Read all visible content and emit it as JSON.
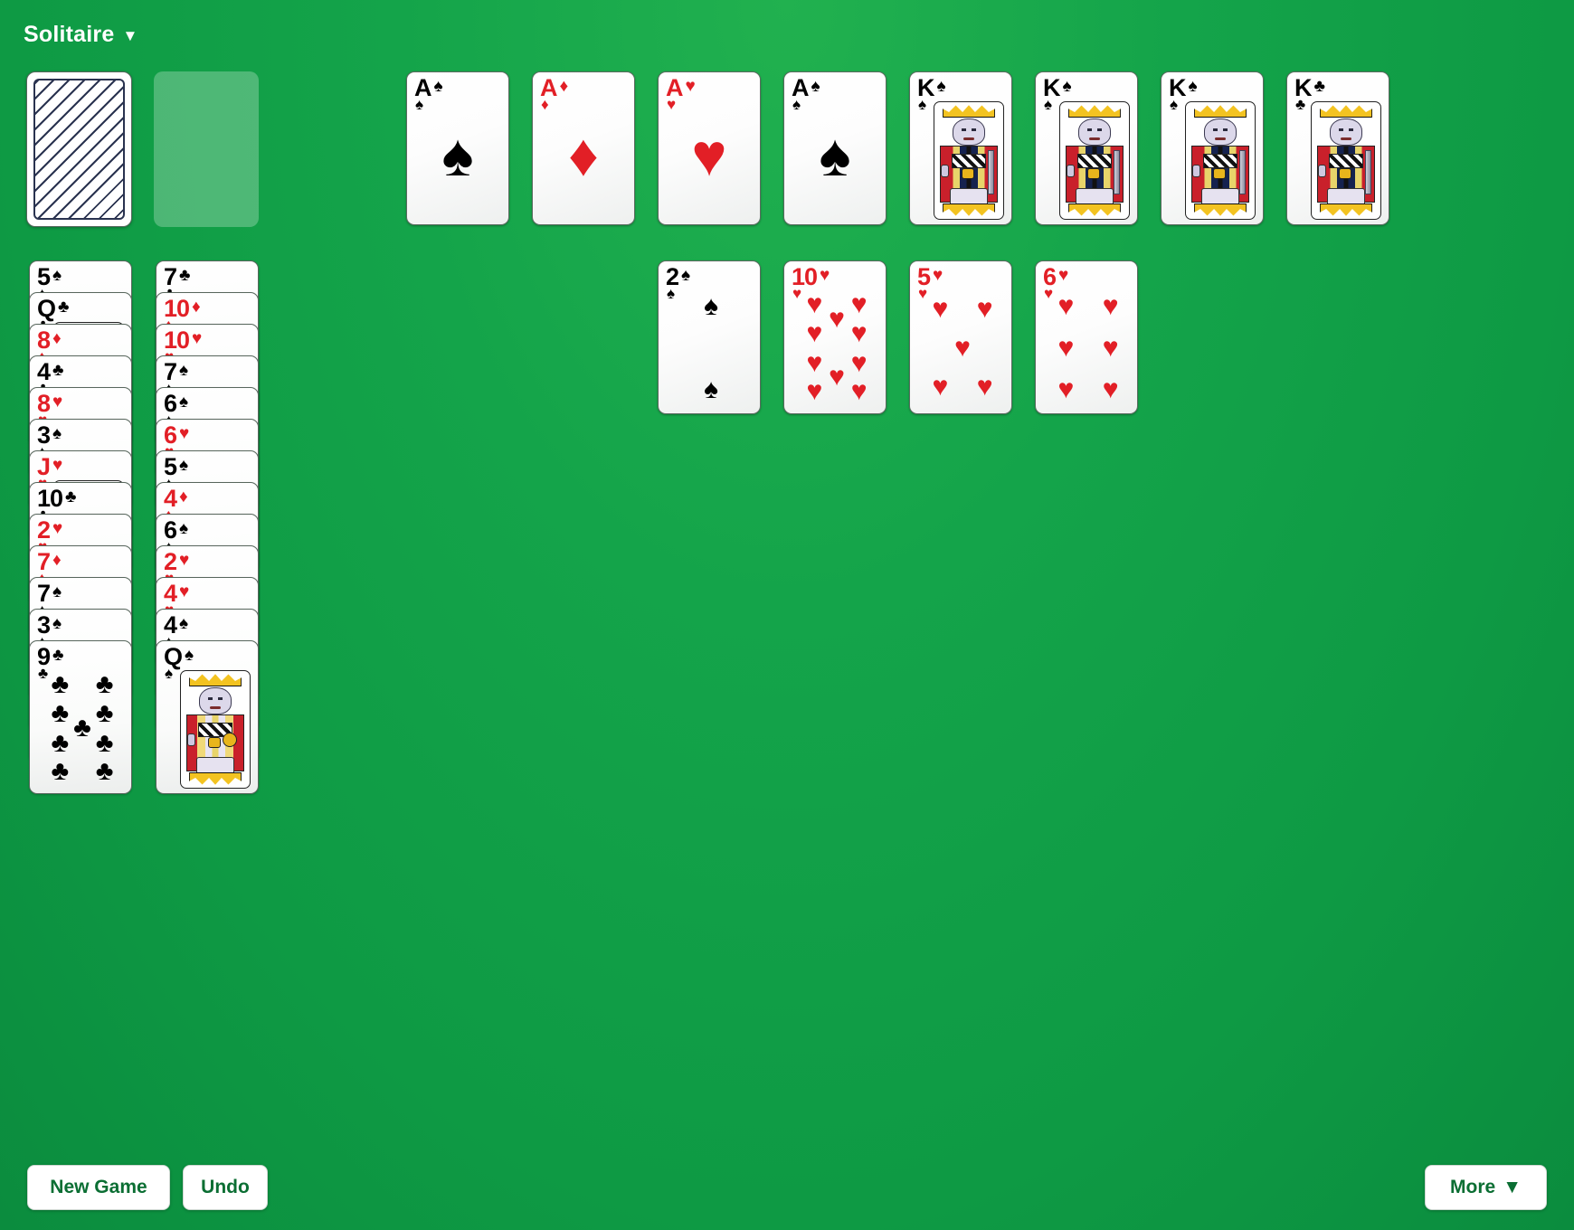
{
  "app": {
    "title": "Solitaire",
    "caret": "▼"
  },
  "colors": {
    "felt": "#14a44a",
    "red_suit": "#e21f26",
    "black_suit": "#000000",
    "button_text": "#0b6e33"
  },
  "stock": {
    "name": "stock-pile",
    "face_down": true
  },
  "waste": {
    "name": "waste-pile",
    "empty": true
  },
  "foundations": [
    {
      "rank": "A",
      "suit": "spades",
      "glyph": "♠",
      "color": "black"
    },
    {
      "rank": "A",
      "suit": "diamonds",
      "glyph": "♦",
      "color": "red"
    },
    {
      "rank": "A",
      "suit": "hearts",
      "glyph": "♥",
      "color": "red"
    },
    {
      "rank": "A",
      "suit": "spades",
      "glyph": "♠",
      "color": "black"
    },
    {
      "rank": "K",
      "suit": "spades",
      "glyph": "♠",
      "color": "black"
    },
    {
      "rank": "K",
      "suit": "spades",
      "glyph": "♠",
      "color": "black"
    },
    {
      "rank": "K",
      "suit": "spades",
      "glyph": "♠",
      "color": "black"
    },
    {
      "rank": "K",
      "suit": "clubs",
      "glyph": "♣",
      "color": "black"
    }
  ],
  "free_row": [
    {
      "rank": "2",
      "suit": "spades",
      "glyph": "♠",
      "color": "black"
    },
    {
      "rank": "10",
      "suit": "hearts",
      "glyph": "♥",
      "color": "red"
    },
    {
      "rank": "5",
      "suit": "hearts",
      "glyph": "♥",
      "color": "red"
    },
    {
      "rank": "6",
      "suit": "hearts",
      "glyph": "♥",
      "color": "red"
    }
  ],
  "tableau": [
    {
      "name": "tableau-column-1",
      "cards": [
        {
          "rank": "5",
          "suit": "spades",
          "glyph": "♠",
          "color": "black"
        },
        {
          "rank": "Q",
          "suit": "clubs",
          "glyph": "♣",
          "color": "black"
        },
        {
          "rank": "8",
          "suit": "diamonds",
          "glyph": "♦",
          "color": "red"
        },
        {
          "rank": "4",
          "suit": "clubs",
          "glyph": "♣",
          "color": "black"
        },
        {
          "rank": "8",
          "suit": "hearts",
          "glyph": "♥",
          "color": "red"
        },
        {
          "rank": "3",
          "suit": "spades",
          "glyph": "♠",
          "color": "black"
        },
        {
          "rank": "J",
          "suit": "hearts",
          "glyph": "♥",
          "color": "red"
        },
        {
          "rank": "10",
          "suit": "clubs",
          "glyph": "♣",
          "color": "black"
        },
        {
          "rank": "2",
          "suit": "hearts",
          "glyph": "♥",
          "color": "red"
        },
        {
          "rank": "7",
          "suit": "diamonds",
          "glyph": "♦",
          "color": "red"
        },
        {
          "rank": "7",
          "suit": "spades",
          "glyph": "♠",
          "color": "black"
        },
        {
          "rank": "3",
          "suit": "spades",
          "glyph": "♠",
          "color": "black"
        },
        {
          "rank": "9",
          "suit": "clubs",
          "glyph": "♣",
          "color": "black"
        }
      ]
    },
    {
      "name": "tableau-column-2",
      "cards": [
        {
          "rank": "7",
          "suit": "clubs",
          "glyph": "♣",
          "color": "black"
        },
        {
          "rank": "10",
          "suit": "diamonds",
          "glyph": "♦",
          "color": "red"
        },
        {
          "rank": "10",
          "suit": "hearts",
          "glyph": "♥",
          "color": "red"
        },
        {
          "rank": "7",
          "suit": "spades",
          "glyph": "♠",
          "color": "black"
        },
        {
          "rank": "6",
          "suit": "spades",
          "glyph": "♠",
          "color": "black"
        },
        {
          "rank": "6",
          "suit": "hearts",
          "glyph": "♥",
          "color": "red"
        },
        {
          "rank": "5",
          "suit": "spades",
          "glyph": "♠",
          "color": "black"
        },
        {
          "rank": "4",
          "suit": "diamonds",
          "glyph": "♦",
          "color": "red"
        },
        {
          "rank": "6",
          "suit": "spades",
          "glyph": "♠",
          "color": "black"
        },
        {
          "rank": "2",
          "suit": "hearts",
          "glyph": "♥",
          "color": "red"
        },
        {
          "rank": "4",
          "suit": "hearts",
          "glyph": "♥",
          "color": "red"
        },
        {
          "rank": "4",
          "suit": "spades",
          "glyph": "♠",
          "color": "black"
        },
        {
          "rank": "Q",
          "suit": "spades",
          "glyph": "♠",
          "color": "black"
        }
      ]
    }
  ],
  "footer": {
    "new_game": "New Game",
    "undo": "Undo",
    "more": "More",
    "more_caret": "▼"
  }
}
